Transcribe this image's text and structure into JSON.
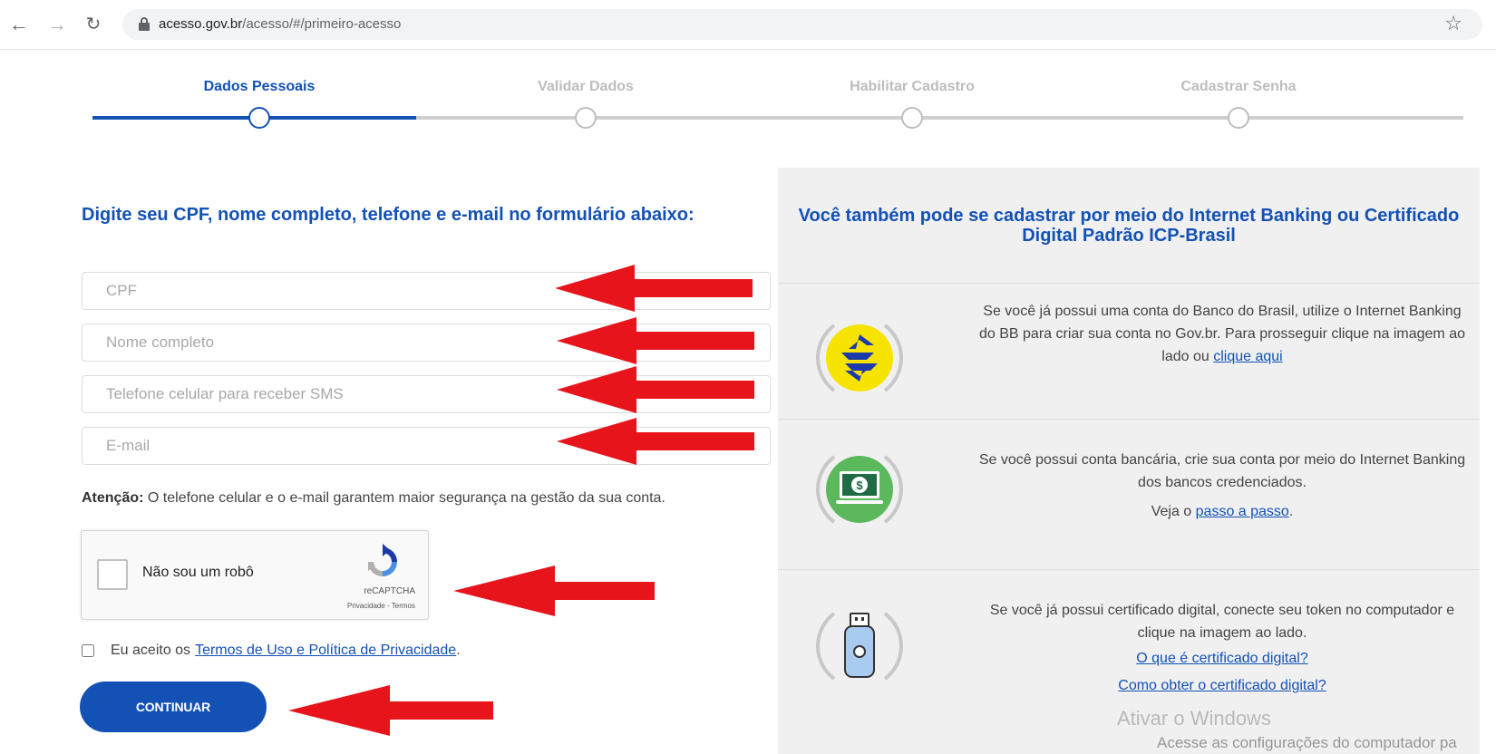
{
  "browser": {
    "url_host": "acesso.gov.br",
    "url_path": "/acesso/#/primeiro-acesso"
  },
  "stepper": {
    "steps": [
      {
        "label": "Dados Pessoais",
        "active": true
      },
      {
        "label": "Validar Dados",
        "active": false
      },
      {
        "label": "Habilitar Cadastro",
        "active": false
      },
      {
        "label": "Cadastrar Senha",
        "active": false
      }
    ],
    "progress_fraction": 0.25
  },
  "form": {
    "title": "Digite seu CPF, nome completo, telefone e e-mail no formulário abaixo:",
    "fields": {
      "cpf_placeholder": "CPF",
      "name_placeholder": "Nome completo",
      "phone_placeholder": "Telefone celular para receber SMS",
      "email_placeholder": "E-mail"
    },
    "attention_label": "Atenção:",
    "attention_text": " O telefone celular e o e-mail garantem maior segurança na gestão da sua conta.",
    "recaptcha": {
      "label": "Não sou um robô",
      "brand": "reCAPTCHA",
      "links": "Privacidade - Termos"
    },
    "terms_prefix": "Eu aceito os",
    "terms_link": "Termos de Uso e Política de Privacidade",
    "terms_suffix": ".",
    "continue_label": "CONTINUAR"
  },
  "panel": {
    "title": "Você também pode se cadastrar por meio do Internet Banking ou Certificado Digital Padrão ICP-Brasil",
    "bb": {
      "text": "Se você já possui uma conta do Banco do Brasil, utilize o Internet Banking do BB para criar sua conta no Gov.br. Para prosseguir clique na imagem ao lado ou ",
      "link": "clique aqui"
    },
    "banks": {
      "text": "Se você possui conta bancária, crie sua conta por meio do Internet Banking dos bancos credenciados.",
      "see_prefix": "Veja o ",
      "link": "passo a passo",
      "see_suffix": "."
    },
    "cert": {
      "text": "Se você já possui certificado digital, conecte seu token no computador e clique na imagem ao lado.",
      "link1": "O que é certificado digital?",
      "link2": "Como obter o certificado digital?"
    }
  },
  "watermark": {
    "line1": "Ativar o Windows",
    "line2": "Acesse as configurações do computador pa"
  },
  "colors": {
    "brand_blue": "#1351b4",
    "arrow_red": "#e8141c",
    "bb_yellow": "#f7e300",
    "green": "#5cb85c"
  }
}
